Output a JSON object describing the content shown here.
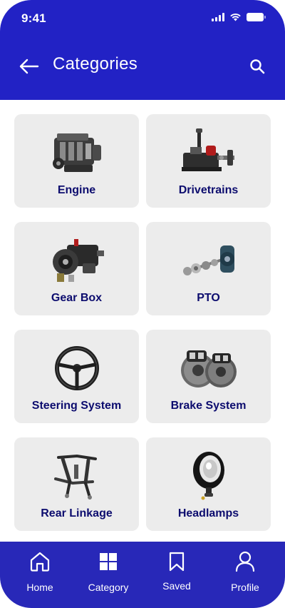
{
  "status_bar": {
    "time": "9:41"
  },
  "header": {
    "title": "Categories"
  },
  "categories": [
    {
      "label": "Engine",
      "icon": "engine-image"
    },
    {
      "label": "Drivetrains",
      "icon": "drivetrain-image"
    },
    {
      "label": "Gear Box",
      "icon": "gearbox-image"
    },
    {
      "label": "PTO",
      "icon": "pto-image"
    },
    {
      "label": "Steering System",
      "icon": "steering-wheel-image"
    },
    {
      "label": "Brake System",
      "icon": "brake-disc-image"
    },
    {
      "label": "Rear Linkage",
      "icon": "rear-linkage-image"
    },
    {
      "label": "Headlamps",
      "icon": "headlamp-image"
    }
  ],
  "bottom_nav": [
    {
      "label": "Home",
      "icon": "home-icon"
    },
    {
      "label": "Category",
      "icon": "grid-icon"
    },
    {
      "label": "Saved",
      "icon": "bookmark-icon"
    },
    {
      "label": "Profile",
      "icon": "user-icon"
    }
  ],
  "colors": {
    "header_bg": "#2222c5",
    "nav_bg": "#2828b8",
    "card_bg": "#ececec",
    "card_label": "#0c0c6e"
  }
}
